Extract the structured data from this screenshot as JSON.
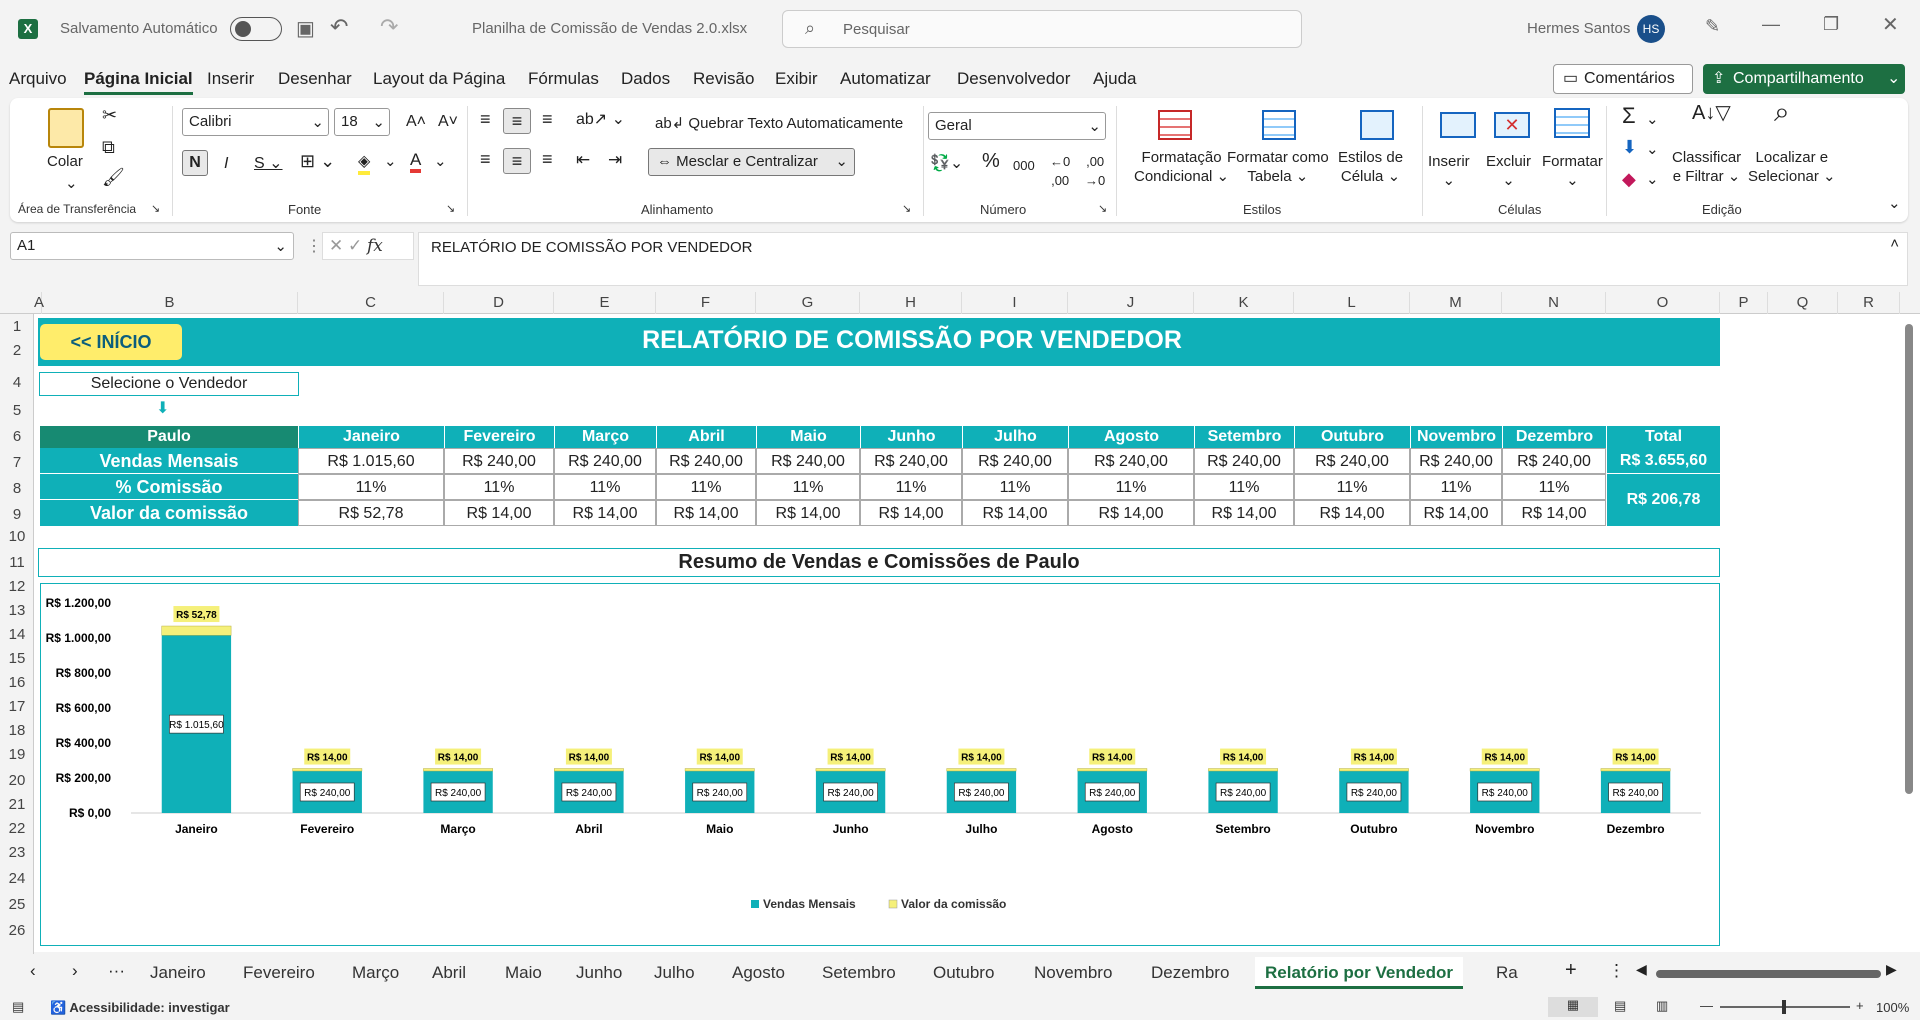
{
  "titlebar": {
    "autosave": "Salvamento Automático",
    "filename": "Planilha de Comissão de Vendas 2.0.xlsx",
    "search": "Pesquisar",
    "user": "Hermes Santos",
    "initials": "HS"
  },
  "menu": [
    "Arquivo",
    "Página Inicial",
    "Inserir",
    "Desenhar",
    "Layout da Página",
    "Fórmulas",
    "Dados",
    "Revisão",
    "Exibir",
    "Automatizar",
    "Desenvolvedor",
    "Ajuda"
  ],
  "menu_right": {
    "comments": "Comentários",
    "share": "Compartilhamento"
  },
  "ribbon": {
    "paste": "Colar",
    "clipboard": "Área de Transferência",
    "font_name": "Calibri",
    "font_size": "18",
    "font": "Fonte",
    "wrap": "Quebrar Texto Automaticamente",
    "merge": "Mesclar e Centralizar",
    "alignment": "Alinhamento",
    "number_format": "Geral",
    "number": "Número",
    "cond1": "Formatação",
    "cond2": "Condicional",
    "fmt_table1": "Formatar como",
    "fmt_table2": "Tabela",
    "cell_styles1": "Estilos de",
    "cell_styles2": "Célula",
    "styles": "Estilos",
    "insert": "Inserir",
    "delete": "Excluir",
    "format": "Formatar",
    "cells": "Células",
    "sort1": "Classificar",
    "sort2": "e Filtrar",
    "find1": "Localizar e",
    "find2": "Selecionar",
    "editing": "Edição"
  },
  "formula": {
    "namebox": "A1",
    "content": "RELATÓRIO DE COMISSÃO POR VENDEDOR"
  },
  "columns": [
    "A",
    "B",
    "C",
    "D",
    "E",
    "F",
    "G",
    "H",
    "I",
    "J",
    "K",
    "L",
    "M",
    "N",
    "O",
    "P",
    "Q",
    "R"
  ],
  "rows": [
    "1",
    "2",
    "4",
    "5",
    "6",
    "7",
    "8",
    "9",
    "10",
    "11",
    "12",
    "13",
    "14",
    "15",
    "16",
    "17",
    "18",
    "19",
    "20",
    "21",
    "22",
    "23",
    "24",
    "25",
    "26"
  ],
  "report": {
    "home_button": "<< INÍCIO",
    "title": "RELATÓRIO DE COMISSÃO POR VENDEDOR",
    "select_label": "Selecione o Vendedor",
    "seller": "Paulo",
    "months": [
      "Janeiro",
      "Fevereiro",
      "Março",
      "Abril",
      "Maio",
      "Junho",
      "Julho",
      "Agosto",
      "Setembro",
      "Outubro",
      "Novembro",
      "Dezembro"
    ],
    "total_header": "Total",
    "row_sales": "Vendas Mensais",
    "row_pct": "% Comissão",
    "row_comm": "Valor da comissão",
    "sales": [
      "R$ 1.015,60",
      "R$ 240,00",
      "R$ 240,00",
      "R$ 240,00",
      "R$ 240,00",
      "R$ 240,00",
      "R$ 240,00",
      "R$ 240,00",
      "R$ 240,00",
      "R$ 240,00",
      "R$ 240,00",
      "R$ 240,00"
    ],
    "pct": [
      "11%",
      "11%",
      "11%",
      "11%",
      "11%",
      "11%",
      "11%",
      "11%",
      "11%",
      "11%",
      "11%",
      "11%"
    ],
    "comm": [
      "R$ 52,78",
      "R$ 14,00",
      "R$ 14,00",
      "R$ 14,00",
      "R$ 14,00",
      "R$ 14,00",
      "R$ 14,00",
      "R$ 14,00",
      "R$ 14,00",
      "R$ 14,00",
      "R$ 14,00",
      "R$ 14,00"
    ],
    "total_sales": "R$ 3.655,60",
    "total_comm": "R$ 206,78",
    "summary_title": "Resumo de Vendas e Comissões de Paulo"
  },
  "chart_data": {
    "type": "bar",
    "stacked": true,
    "categories": [
      "Janeiro",
      "Fevereiro",
      "Março",
      "Abril",
      "Maio",
      "Junho",
      "Julho",
      "Agosto",
      "Setembro",
      "Outubro",
      "Novembro",
      "Dezembro"
    ],
    "series": [
      {
        "name": "Vendas Mensais",
        "color": "#0fb0b8",
        "values": [
          1015.6,
          240,
          240,
          240,
          240,
          240,
          240,
          240,
          240,
          240,
          240,
          240
        ]
      },
      {
        "name": "Valor da comissão",
        "color": "#f5f07a",
        "values": [
          52.78,
          14,
          14,
          14,
          14,
          14,
          14,
          14,
          14,
          14,
          14,
          14
        ]
      }
    ],
    "sales_labels": [
      "R$ 1.015,60",
      "R$ 240,00",
      "R$ 240,00",
      "R$ 240,00",
      "R$ 240,00",
      "R$ 240,00",
      "R$ 240,00",
      "R$ 240,00",
      "R$ 240,00",
      "R$ 240,00",
      "R$ 240,00",
      "R$ 240,00"
    ],
    "comm_labels": [
      "R$ 52,78",
      "R$ 14,00",
      "R$ 14,00",
      "R$ 14,00",
      "R$ 14,00",
      "R$ 14,00",
      "R$ 14,00",
      "R$ 14,00",
      "R$ 14,00",
      "R$ 14,00",
      "R$ 14,00",
      "R$ 14,00"
    ],
    "ylim": [
      0,
      1200
    ],
    "yticks": [
      0,
      200,
      400,
      600,
      800,
      1000,
      1200
    ],
    "ytick_labels": [
      "R$ 0,00",
      "R$ 200,00",
      "R$ 400,00",
      "R$ 600,00",
      "R$ 800,00",
      "R$ 1.000,00",
      "R$ 1.200,00"
    ],
    "legend": "bottom"
  },
  "sheet_tabs": [
    "Janeiro",
    "Fevereiro",
    "Março",
    "Abril",
    "Maio",
    "Junho",
    "Julho",
    "Agosto",
    "Setembro",
    "Outubro",
    "Novembro",
    "Dezembro",
    "Relatório por Vendedor",
    "Ra"
  ],
  "status": {
    "accessibility": "Acessibilidade: investigar",
    "zoom": "100%"
  }
}
